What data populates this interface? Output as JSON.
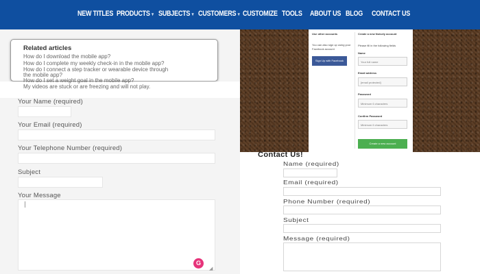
{
  "nav": {
    "items": [
      {
        "label": "NEW TITLES",
        "caret": ""
      },
      {
        "label": "PRODUCTS",
        "caret": "▾"
      },
      {
        "label": "SUBJECTS",
        "caret": "▾"
      },
      {
        "label": "CUSTOMERS",
        "caret": "▾"
      },
      {
        "label": "CUSTOMIZE",
        "caret": ""
      },
      {
        "label": "TOOLS",
        "caret": ""
      },
      {
        "label": "ABOUT US",
        "caret": ""
      },
      {
        "label": "BLOG",
        "caret": ""
      },
      {
        "label": "CONTACT US",
        "caret": ""
      }
    ]
  },
  "related": {
    "title": "Related articles",
    "links": [
      "How do I download the mobile app?",
      "How do I complete my weekly check-in in the mobile app?",
      "How do I connect a step tracker or wearable device through",
      "the mobile app?",
      "How do I set a weight goal in the mobile app?",
      "My videos are stuck or are freezing and will not play."
    ]
  },
  "form_left": {
    "name_label": "Your Name (required)",
    "email_label": "Your Email (required)",
    "phone_label": "Your Telephone Number (required)",
    "subject_label": "Subject",
    "message_label": "Your Message",
    "grammarly_badge": "G"
  },
  "signup": {
    "left_heading": "Use other accounts",
    "left_text_1": "You can also sign up using your",
    "left_text_2": "Facebook account",
    "facebook_button": "Sign Up with Facebook",
    "right_heading": "Create a new Noisely account",
    "right_subtext": "Please fill in the following fields",
    "name_label": "Name",
    "name_placeholder": "Your full name",
    "email_label": "Email address",
    "email_placeholder": "[email protected]",
    "password_label": "Password",
    "password_placeholder": "Minimum 6 characters",
    "confirm_label": "Confirm Password",
    "confirm_placeholder": "Minimum 6 characters",
    "create_button": "Create a new account"
  },
  "contact": {
    "title": "Contact Us!",
    "name_label": "Name (required)",
    "email_label": "Email (required)",
    "phone_label": "Phone Number (required)",
    "subject_label": "Subject",
    "message_label": "Message (required)"
  },
  "colors": {
    "nav_bg": "#0f4fa0",
    "facebook": "#3b5998",
    "create_button": "#4caf50",
    "grammarly": "#e6337a"
  }
}
